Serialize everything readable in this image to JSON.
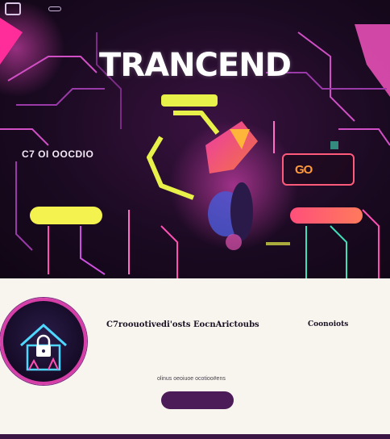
{
  "nav": {
    "links": [
      "",
      "",
      "",
      "",
      "",
      ""
    ]
  },
  "hero": {
    "title": "TRANCEND",
    "left_heading": "C7 OI OOCDIO",
    "left_body": "",
    "left_button_label": "",
    "card_icon_text": "GO",
    "right_body": "",
    "right_button_label": ""
  },
  "content": {
    "title": "C7roouotivedi'osts EocnArictoubs",
    "body": "",
    "body2": "",
    "caption": "olinus oeoiuoe ocotioo#ens",
    "button_label": "",
    "side_title": "Coonoiots",
    "side_body": "",
    "side_body2": ""
  },
  "colors": {
    "accent_pink": "#ff3fa8",
    "accent_yellow": "#e8f04a",
    "accent_purple": "#4b1c58",
    "content_bg": "#f8f4ee"
  }
}
